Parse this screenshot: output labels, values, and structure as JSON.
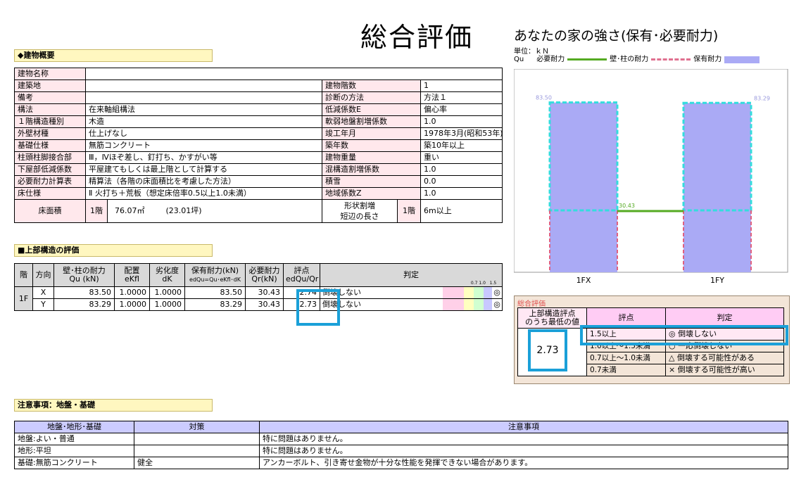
{
  "page": {
    "title": "総合評価",
    "chart_title": "あなたの家の強さ(保有･必要耐力)"
  },
  "overview": {
    "header": "◆建物概要",
    "left_rows": [
      {
        "label": "建物名称",
        "value": ""
      },
      {
        "label": "建築地",
        "value": ""
      },
      {
        "label": "備考",
        "value": ""
      },
      {
        "label": "構法",
        "value": "在来軸組構法"
      },
      {
        "label": "１階構造種別",
        "value": "木造"
      },
      {
        "label": "外壁材種",
        "value": "仕上げなし"
      },
      {
        "label": "基礎仕様",
        "value": "無筋コンクリート"
      },
      {
        "label": "柱頭柱脚接合部",
        "value": "Ⅲ，Ⅳほぞ差し、釘打ち、かすがい等"
      },
      {
        "label": "下屋部低減係数",
        "value": "平屋建てもしくは最上階として計算する"
      },
      {
        "label": "必要耐力計算表",
        "value": "精算法（各階の床面積比を考慮した方法）"
      },
      {
        "label": "床仕様",
        "value": "Ⅱ 火打ち＋荒板（想定床倍率0.5以上1.0未満）"
      }
    ],
    "right_rows": [
      {
        "label": "建物階数",
        "value": "1"
      },
      {
        "label": "診断の方法",
        "value": "方法１"
      },
      {
        "label": "低減係数E",
        "value": "偏心率"
      },
      {
        "label": "軟弱地盤割増係数",
        "value": "1.0"
      },
      {
        "label": "竣工年月",
        "value": "1978年3月(昭和53年)"
      },
      {
        "label": "築年数",
        "value": "築10年以上"
      },
      {
        "label": "建物重量",
        "value": "重い"
      },
      {
        "label": "混構造割増係数",
        "value": "1.0"
      },
      {
        "label": "積雪",
        "value": "0.0"
      },
      {
        "label": "地域係数Z",
        "value": "1.0"
      }
    ],
    "floor_area": {
      "label": "床面積",
      "floor": "1階",
      "value": "76.07㎡",
      "tsubo": "(23.01坪)",
      "shape_label_1": "形状割増",
      "shape_label_2": "短辺の長さ",
      "shape_floor": "1階",
      "shape_value": "6m以上"
    }
  },
  "structure": {
    "header": "■上部構造の評価",
    "columns": {
      "floor": "階",
      "dir": "方向",
      "qu_1": "壁･柱の耐力",
      "qu_2": "Qu (kN)",
      "ekfl_1": "配置",
      "ekfl_2": "eKfl",
      "dk_1": "劣化度",
      "dk_2": "dK",
      "edqu_1": "保有耐力(kN)",
      "edqu_2": "edQu=Qu･eKfl･dK",
      "qr_1": "必要耐力",
      "qr_2": "Qr(kN)",
      "score_1": "評点",
      "score_2": "edQu/Qr",
      "judge": "判定"
    },
    "scale_labels": [
      "0.7",
      "1.0",
      "1.5"
    ],
    "floor_label": "1F",
    "rows": [
      {
        "dir": "X",
        "qu": "83.50",
        "ekfl": "1.0000",
        "dk": "1.0000",
        "edqu": "83.50",
        "qr": "30.43",
        "score": "2.74",
        "judge": "倒壊しない",
        "mark": "◎"
      },
      {
        "dir": "Y",
        "qu": "83.29",
        "ekfl": "1.0000",
        "dk": "1.0000",
        "edqu": "83.29",
        "qr": "30.43",
        "score": "2.73",
        "judge": "倒壊しない",
        "mark": "◎"
      }
    ]
  },
  "chart_data": {
    "type": "bar",
    "title": "あなたの家の強さ(保有･必要耐力)",
    "unit_label": "単位：ｋＮ",
    "legend": {
      "qu": "Qu",
      "required": "必要耐力",
      "wall": "壁･柱の耐力",
      "held": "保有耐力"
    },
    "categories": [
      "1FX",
      "1FY"
    ],
    "series": [
      {
        "name": "保有耐力",
        "values": [
          83.5,
          83.29
        ]
      },
      {
        "name": "必要耐力",
        "values": [
          30.43,
          30.43
        ]
      }
    ],
    "value_labels": {
      "qu": [
        "83.50",
        "83.29"
      ],
      "required": "30.43"
    },
    "ylim": [
      0,
      100
    ],
    "colors": {
      "held": "#aaaaf5",
      "wall": "#33dddd",
      "required": "#55aa22",
      "lower": "#e06080"
    }
  },
  "summary": {
    "header": "総合評価",
    "min_label_1": "上部構造評点",
    "min_label_2": "のうち最低の値",
    "min_value": "2.73",
    "col_score": "評点",
    "col_judge": "判定",
    "rows": [
      {
        "range": "1.5以上",
        "judge": "◎ 倒壊しない"
      },
      {
        "range": "1.0以上～1.5未満",
        "judge": "○ 一応倒壊しない"
      },
      {
        "range": "0.7以上～1.0未満",
        "judge": "△ 倒壊する可能性がある"
      },
      {
        "range": "0.7未満",
        "judge": "× 倒壊する可能性が高い"
      }
    ]
  },
  "notes": {
    "header": "注意事項：地盤・基礎",
    "columns": {
      "item": "地盤･地形･基礎",
      "measure": "対策",
      "note": "注意事項"
    },
    "rows": [
      {
        "item": "地盤:よい・普通",
        "measure": "",
        "note": "特に問題はありません。"
      },
      {
        "item": "地形:平坦",
        "measure": "",
        "note": "特に問題はありません。"
      },
      {
        "item": "基礎:無筋コンクリート",
        "measure": "健全",
        "note": "アンカーボルト、引き寄せ金物が十分な性能を発揮できない場合があります。"
      }
    ]
  }
}
